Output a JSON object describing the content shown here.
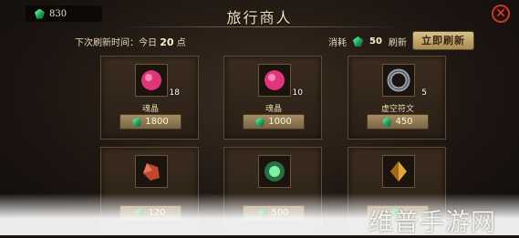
{
  "header": {
    "currency_amount": "830",
    "title": "旅行商人",
    "close_label": "⊗"
  },
  "refresh": {
    "next_label": "下次刷新时间：",
    "day_label": "今日",
    "hour": "20",
    "hour_unit": "点",
    "cost_label": "消耗",
    "cost_amount": "50",
    "cost_action": "刷新",
    "button_label": "立即刷新"
  },
  "items": [
    {
      "name": "魂晶",
      "count": "18",
      "price": "1800",
      "icon": "soul-crystal-icon",
      "color": "#e0357a"
    },
    {
      "name": "魂晶",
      "count": "10",
      "price": "1000",
      "icon": "soul-crystal-icon",
      "color": "#e0357a"
    },
    {
      "name": "虚空符文",
      "count": "5",
      "price": "450",
      "icon": "void-rune-icon",
      "color": "#8a8e96"
    },
    {
      "name": "",
      "count": "",
      "price": "120",
      "icon": "red-crystal-icon",
      "color": "#c0472d"
    },
    {
      "name": "",
      "count": "",
      "price": "500",
      "icon": "green-orb-icon",
      "color": "#4fd07a"
    },
    {
      "name": "",
      "count": "",
      "price": "",
      "icon": "amber-crystal-icon",
      "color": "#e1a53a"
    }
  ],
  "watermark": "维普手游网"
}
